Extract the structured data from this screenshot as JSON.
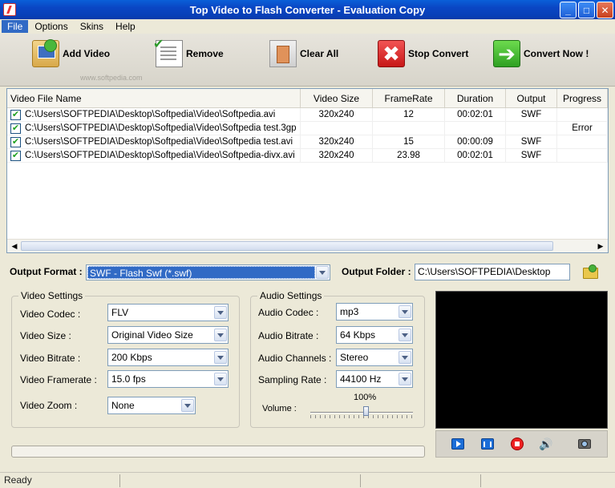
{
  "window": {
    "title": "Top Video to Flash Converter - Evaluation Copy",
    "minimize": "_",
    "maximize": "□",
    "close": "✕"
  },
  "menu": [
    "File",
    "Options",
    "Skins",
    "Help"
  ],
  "toolbar": {
    "add_label": "Add Video",
    "remove_label": "Remove",
    "clear_label": "Clear All",
    "stop_label": "Stop Convert",
    "convert_label": "Convert Now !",
    "stop_glyph": "✖",
    "convert_glyph": "➔",
    "watermark": "www.softpedia.com"
  },
  "file_list": {
    "columns": [
      "Video File Name",
      "Video Size",
      "FrameRate",
      "Duration",
      "Output",
      "Progress"
    ],
    "rows": [
      {
        "checked": true,
        "name": "C:\\Users\\SOFTPEDIA\\Desktop\\Softpedia\\Video\\Softpedia.avi",
        "size": "320x240",
        "framerate": "12",
        "duration": "00:02:01",
        "output": "SWF",
        "progress": ""
      },
      {
        "checked": true,
        "name": "C:\\Users\\SOFTPEDIA\\Desktop\\Softpedia\\Video\\Softpedia test.3gp",
        "size": "",
        "framerate": "",
        "duration": "",
        "output": "",
        "progress": "Error"
      },
      {
        "checked": true,
        "name": "C:\\Users\\SOFTPEDIA\\Desktop\\Softpedia\\Video\\Softpedia test.avi",
        "size": "320x240",
        "framerate": "15",
        "duration": "00:00:09",
        "output": "SWF",
        "progress": ""
      },
      {
        "checked": true,
        "name": "C:\\Users\\SOFTPEDIA\\Desktop\\Softpedia\\Video\\Softpedia-divx.avi",
        "size": "320x240",
        "framerate": "23.98",
        "duration": "00:02:01",
        "output": "SWF",
        "progress": ""
      }
    ],
    "scroll_left": "◀",
    "scroll_right": "▶"
  },
  "output": {
    "format_label": "Output Format :",
    "format_value": "SWF - Flash Swf (*.swf)",
    "folder_label": "Output Folder :",
    "folder_value": "C:\\Users\\SOFTPEDIA\\Desktop"
  },
  "video_settings": {
    "title": "Video Settings",
    "codec_label": "Video Codec :",
    "codec_value": "FLV",
    "size_label": "Video Size :",
    "size_value": "Original Video Size",
    "bitrate_label": "Video Bitrate :",
    "bitrate_value": "200 Kbps",
    "framerate_label": "Video Framerate :",
    "framerate_value": "15.0 fps",
    "zoom_label": "Video Zoom :",
    "zoom_value": "None"
  },
  "audio_settings": {
    "title": "Audio Settings",
    "codec_label": "Audio Codec :",
    "codec_value": "mp3",
    "bitrate_label": "Audio Bitrate :",
    "bitrate_value": "64 Kbps",
    "channels_label": "Audio Channels :",
    "channels_value": "Stereo",
    "sampling_label": "Sampling Rate :",
    "sampling_value": "44100 Hz",
    "volume_label": "Volume :",
    "volume_value": "100%",
    "volume_level": 0.55
  },
  "player": {
    "volume_glyph": "🔊"
  },
  "status": {
    "text": "Ready"
  },
  "colors": {
    "titlebar": "#0a46c4",
    "selection": "#316ac5",
    "error_text": "#000000"
  }
}
